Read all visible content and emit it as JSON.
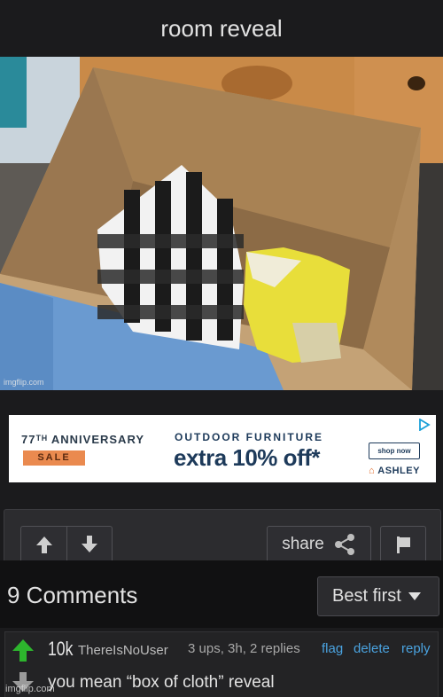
{
  "post": {
    "title": "room reveal",
    "image_watermark": "imgflip.com"
  },
  "ad": {
    "anniversary": "77ᵀᴴ ANNIVERSARY",
    "sale": "SALE",
    "headline": "OUTDOOR FURNITURE",
    "offer": "extra 10% off*",
    "cta": "shop now",
    "brand": "ASHLEY"
  },
  "actions": {
    "share_label": "share"
  },
  "comments": {
    "count_label": "9 Comments",
    "sort_label": "Best first",
    "items": [
      {
        "score": "10k",
        "user": "ThereIsNoUser",
        "meta": "3 ups, 3h, 2 replies",
        "flag": "flag",
        "delete": "delete",
        "reply": "reply",
        "text": "you mean “box of cloth” reveal"
      }
    ]
  },
  "bottom_watermark": "imgflip.com",
  "colors": {
    "background": "#1b1b1d",
    "link": "#4aa3e0",
    "upvote": "#2db52d"
  }
}
